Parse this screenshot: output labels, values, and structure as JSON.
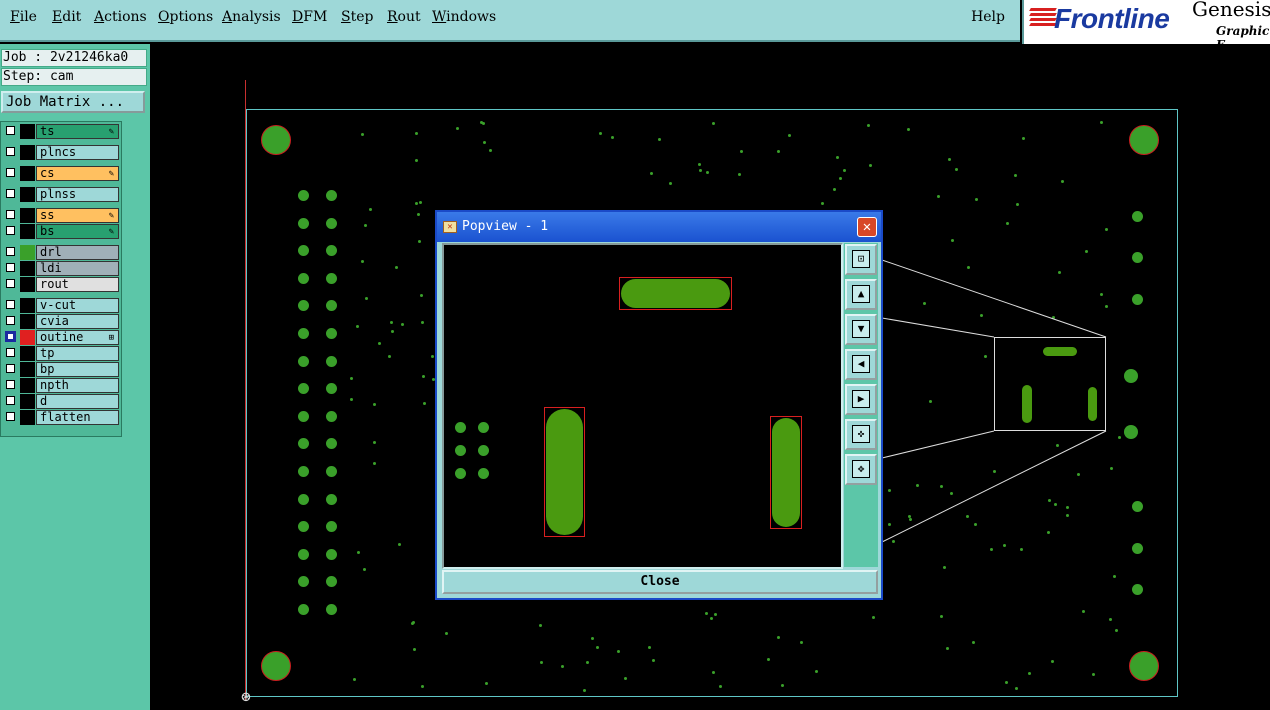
{
  "menu": {
    "items": [
      "File",
      "Edit",
      "Actions",
      "Options",
      "Analysis",
      "DFM",
      "Step",
      "Rout",
      "Windows"
    ],
    "help": "Help"
  },
  "brand": {
    "logo": "Frontline",
    "product": "Genesis",
    "subtitle": "Graphic E"
  },
  "info": {
    "job": "Job : 2v21246ka0",
    "step": "Step: cam",
    "job_matrix": "Job Matrix ..."
  },
  "layers": [
    {
      "name": "ts",
      "color": "#28a070",
      "swatch": "#000",
      "marker": "✎"
    },
    {
      "name": "plncs",
      "color": "#9ed8d8",
      "swatch": "#000",
      "marker": ""
    },
    {
      "name": "cs",
      "color": "#ffc060",
      "swatch": "#000",
      "marker": "✎"
    },
    {
      "name": "plnss",
      "color": "#9ed8d8",
      "swatch": "#000",
      "marker": ""
    },
    {
      "name": "ss",
      "color": "#ffc060",
      "swatch": "#000",
      "marker": "✎"
    },
    {
      "name": "bs",
      "color": "#28a070",
      "swatch": "#000",
      "marker": "✎"
    },
    {
      "name": "drl",
      "color": "#a0b0b8",
      "swatch": "#3aa02a",
      "marker": ""
    },
    {
      "name": "ldi",
      "color": "#a0b0b8",
      "swatch": "#000",
      "marker": ""
    },
    {
      "name": "rout",
      "color": "#e0e0e0",
      "swatch": "#000",
      "marker": ""
    },
    {
      "name": "v-cut",
      "color": "#9ed8d8",
      "swatch": "#000",
      "marker": ""
    },
    {
      "name": "cvia",
      "color": "#9ed8d8",
      "swatch": "#000",
      "marker": ""
    },
    {
      "name": "outine",
      "color": "#9ed8d8",
      "swatch": "#e02020",
      "marker": "⊞",
      "selected": true
    },
    {
      "name": "tp",
      "color": "#9ed8d8",
      "swatch": "#000",
      "marker": ""
    },
    {
      "name": "bp",
      "color": "#9ed8d8",
      "swatch": "#000",
      "marker": ""
    },
    {
      "name": "npth",
      "color": "#9ed8d8",
      "swatch": "#000",
      "marker": ""
    },
    {
      "name": "d",
      "color": "#9ed8d8",
      "swatch": "#000",
      "marker": ""
    },
    {
      "name": "flatten",
      "color": "#9ed8d8",
      "swatch": "#000",
      "marker": ""
    }
  ],
  "popview": {
    "title": "Popview - 1",
    "close_label": "Close",
    "close_x": "✕"
  },
  "colors": {
    "pad": "#3aa02a",
    "board_outline": "#5fc6c6",
    "panel": "#5cc6a8",
    "menubar": "#9ed8d8"
  }
}
